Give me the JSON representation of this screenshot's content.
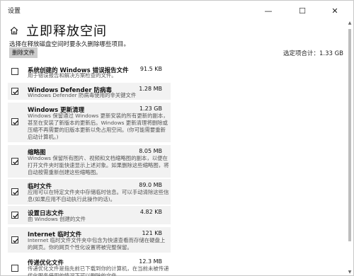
{
  "window": {
    "title": "设置",
    "controls": {
      "minimize": "—",
      "maximize": "☐",
      "close": "✕"
    }
  },
  "header": {
    "title": "立即释放空间"
  },
  "description": "选择在释放磁盘空间时要永久删除哪些项目。",
  "delete_button": "删除文件",
  "total": "选定项合计：1.33 GB",
  "items": [
    {
      "name": "系统创建的 Windows 错误报告文件",
      "size": "91.5 KB",
      "checked": false,
      "desc": "用于错误报告和解决方案检查的文件。"
    },
    {
      "name": "Windows Defender 防病毒",
      "size": "1.28 MB",
      "checked": true,
      "desc": "Windows Defender 防病毒使用的非关键文件"
    },
    {
      "name": "Windows 更新清理",
      "size": "1.23 GB",
      "checked": true,
      "desc": "Windows 保留通过 Windows 更新安装的所有更新的副本，甚至在安装了新版本的更新后。Windows 更新清理将删除或压缩不再需要的旧版本更新以免占用空间。(你可能需要重新启动计算机。)"
    },
    {
      "name": "缩略图",
      "size": "8.05 MB",
      "checked": true,
      "desc": "Windows 保留所有图片、视频和文档缩略图的副本，以便在打开文件夹时能快速显示上述对象。如果删除这些缩略图，将自动按需重新创建这些缩略图。"
    },
    {
      "name": "临时文件",
      "size": "89.0 MB",
      "checked": true,
      "desc": "应用可以在特定文件夹中存储临时信息。可以手动清除这些信息(如果应用不自动执行此操作的话)。"
    },
    {
      "name": "设置日志文件",
      "size": "4.82 KB",
      "checked": true,
      "desc": "由 Windows 创建的文件"
    },
    {
      "name": "Internet 临时文件",
      "size": "121 KB",
      "checked": true,
      "desc": "Internet 临时文件文件夹中包含为快速查看而存储在硬盘上的网页。你的网页个性化设置将被完整保留。"
    },
    {
      "name": "传递优化文件",
      "size": "12.3 MB",
      "checked": false,
      "desc": "传递优化文件是指先前已下载到你的计算机，在当前未被传递优化服务使用的情况下可以删除的文件。"
    }
  ]
}
